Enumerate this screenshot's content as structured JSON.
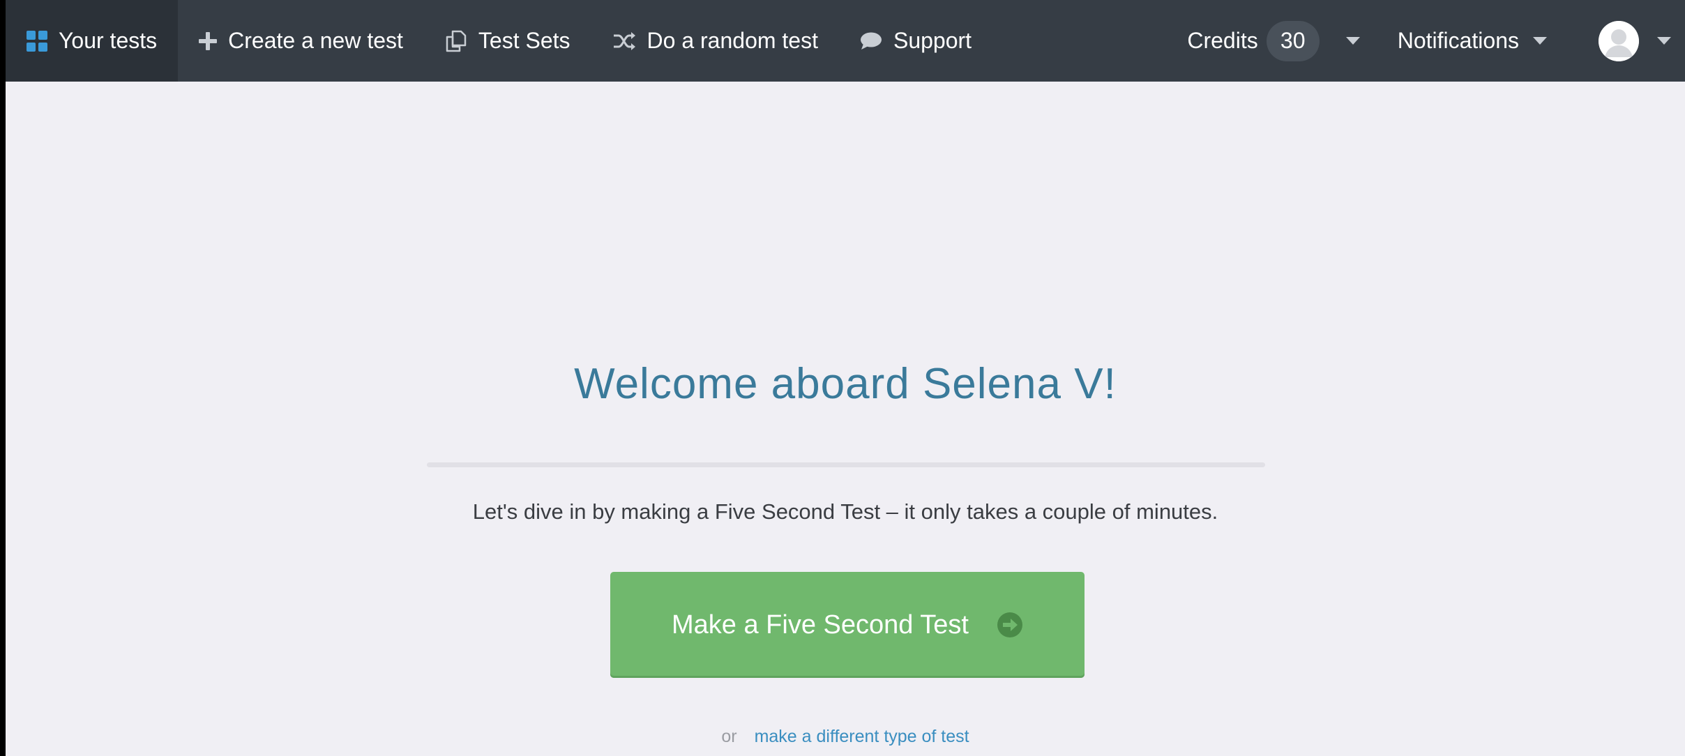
{
  "nav": {
    "your_tests": "Your tests",
    "create_new_test": "Create a new test",
    "test_sets": "Test Sets",
    "random_test": "Do a random test",
    "support": "Support",
    "credits_label": "Credits",
    "credits_count": "30",
    "notifications": "Notifications"
  },
  "main": {
    "welcome": "Welcome aboard Selena V!",
    "intro": "Let's dive in by making a Five Second Test – it only takes a couple of minutes.",
    "cta_label": "Make a Five Second Test",
    "or_text": "or",
    "alt_link": "make a different type of test"
  },
  "icons": {
    "your_tests": "grid-icon",
    "create_new_test": "plus-icon",
    "test_sets": "copy-icon",
    "random_test": "shuffle-icon",
    "support": "speech-bubble-icon",
    "cta": "arrow-circle-right-icon"
  },
  "colors": {
    "nav_bg": "#363d45",
    "nav_active_bg": "#2b3138",
    "page_bg": "#f0eff4",
    "welcome_text": "#3a7a9a",
    "cta_bg": "#70b86d",
    "link": "#3a8ec0",
    "grid_icon": "#3a9ad9"
  }
}
